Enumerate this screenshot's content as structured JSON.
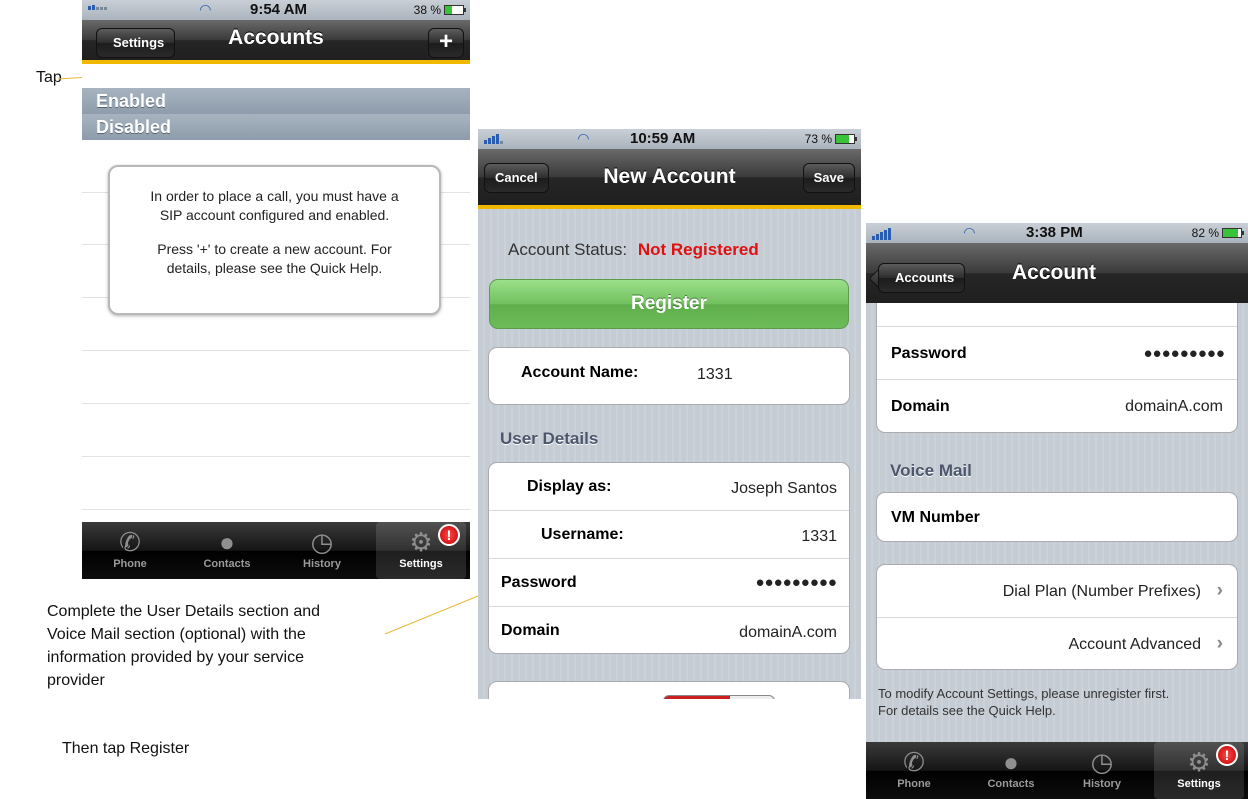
{
  "annotations": {
    "tap": "Tap",
    "complete": "Complete the User Details section and Voice Mail section (optional) with the information provided by your service provider",
    "complete_lines": [
      "Complete the User Details section and",
      "Voice Mail section (optional) with the",
      "information provided by your service",
      "provider"
    ],
    "then": "Then tap Register"
  },
  "colors": {
    "accent": "#f0b800",
    "register_green": "#72c05f",
    "not_registered_red": "#e01010"
  },
  "screen1": {
    "status": {
      "time": "9:54 AM",
      "battery": "38 %"
    },
    "nav": {
      "back": "Settings",
      "title": "Accounts",
      "add": "+"
    },
    "sections": [
      "Enabled",
      "Disabled"
    ],
    "message_lines": [
      "In order to place a call, you must have a",
      "SIP account configured and enabled.",
      "",
      "Press '+' to create a new account. For",
      "details, please see the Quick Help."
    ],
    "tabs": [
      {
        "label": "Phone",
        "icon": "phone-icon"
      },
      {
        "label": "Contacts",
        "icon": "contacts-icon"
      },
      {
        "label": "History",
        "icon": "history-icon"
      },
      {
        "label": "Settings",
        "icon": "settings-icon",
        "badge": "!"
      }
    ]
  },
  "screen2": {
    "status": {
      "time": "10:59 AM",
      "battery": "73 %"
    },
    "nav": {
      "cancel": "Cancel",
      "title": "New Account",
      "save": "Save"
    },
    "status_label": "Account Status:",
    "status_value": "Not Registered",
    "register": "Register",
    "account_name_label": "Account Name:",
    "account_name_value": "1331",
    "user_details_title": "User Details",
    "display_as_label": "Display as:",
    "display_as_value": "Joseph Santos",
    "username_label": "Username:",
    "username_value": "1331",
    "password_label": "Password",
    "password_value": "●●●●●●●●●",
    "domain_label": "Domain",
    "domain_value": "domainA.com"
  },
  "screen3": {
    "status": {
      "time": "3:38 PM",
      "battery": "82 %"
    },
    "nav": {
      "back": "Accounts",
      "title": "Account"
    },
    "password_label": "Password",
    "password_value": "●●●●●●●●●",
    "domain_label": "Domain",
    "domain_value": "domainA.com",
    "voice_mail_title": "Voice Mail",
    "vm_label": "VM Number",
    "dial_plan": "Dial Plan (Number Prefixes)",
    "account_advanced": "Account Advanced",
    "footer_lines": [
      "To modify Account Settings, please unregister first.",
      "For details see the Quick Help."
    ],
    "tabs": [
      {
        "label": "Phone",
        "icon": "phone-icon"
      },
      {
        "label": "Contacts",
        "icon": "contacts-icon"
      },
      {
        "label": "History",
        "icon": "history-icon"
      },
      {
        "label": "Settings",
        "icon": "settings-icon",
        "badge": "!"
      }
    ]
  }
}
